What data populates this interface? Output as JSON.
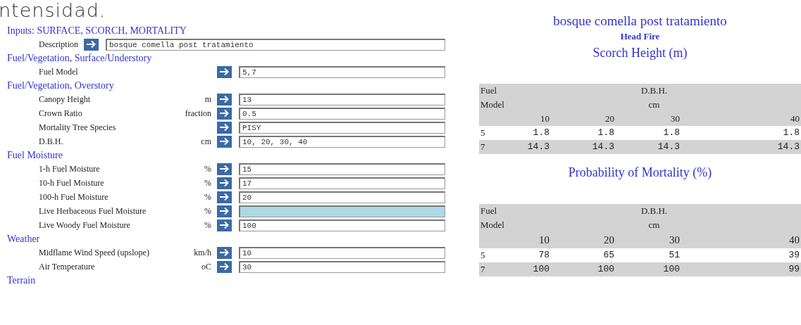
{
  "intro_text": "ntensidad.",
  "inputs": {
    "title": "Inputs: SURFACE, SCORCH, MORTALITY",
    "description": {
      "label": "Description",
      "value": "bosque comella post tratamiento"
    },
    "sections": [
      {
        "title": "Fuel/Vegetation, Surface/Understory",
        "fields": [
          {
            "label": "Fuel Model",
            "value": "5,7",
            "highlighted": false
          }
        ]
      },
      {
        "title": "Fuel/Vegetation, Overstory",
        "fields": [
          {
            "label": "Canopy Height",
            "unit": "m",
            "value": "13",
            "highlighted": false
          },
          {
            "label": "Crown Ratio",
            "unit": "fraction",
            "value": "0.5",
            "highlighted": false
          },
          {
            "label": "Mortality Tree Species",
            "value": "PISY",
            "highlighted": false
          },
          {
            "label": "D.B.H.",
            "unit": "cm",
            "value": "10, 20, 30, 40",
            "highlighted": false
          }
        ]
      },
      {
        "title": "Fuel Moisture",
        "fields": [
          {
            "label": "1-h Fuel Moisture",
            "unit": "%",
            "value": "15",
            "highlighted": false
          },
          {
            "label": "10-h Fuel Moisture",
            "unit": "%",
            "value": "17",
            "highlighted": false
          },
          {
            "label": "100-h Fuel Moisture",
            "unit": "%",
            "value": "20",
            "highlighted": false
          },
          {
            "label": "Live Herbaceous Fuel Moisture",
            "unit": "%",
            "highlighted": true
          },
          {
            "label": "Live Woody Fuel Moisture",
            "unit": "%",
            "value": "100",
            "highlighted": false
          }
        ]
      },
      {
        "title": "Weather",
        "fields": [
          {
            "label": "Midflame Wind Speed (upslope)",
            "unit": "km/h",
            "value": "10",
            "highlighted": false
          },
          {
            "label": "Air Temperature",
            "unit": "oC",
            "value": "30",
            "highlighted": false
          }
        ]
      },
      {
        "title": "Terrain"
      }
    ]
  },
  "results": {
    "title": "bosque comella post tratamiento",
    "subtitle": "Head Fire",
    "tables": [
      {
        "title": "Scorch Height (m)",
        "first_header": [
          "Fuel",
          "Model"
        ],
        "group_header": [
          "D.B.H.",
          "cm"
        ],
        "columns": [
          "10",
          "20",
          "30",
          "40"
        ],
        "rows": [
          {
            "fuel_model": "5",
            "values": [
              "1.8",
              "1.8",
              "1.8",
              "1.8"
            ]
          },
          {
            "fuel_model": "7",
            "values": [
              "14.3",
              "14.3",
              "14.3",
              "14.3"
            ]
          }
        ]
      },
      {
        "title": "Probability of Mortality (%)",
        "first_header": [
          "Fuel",
          "Model"
        ],
        "group_header": [
          "D.B.H.",
          "cm"
        ],
        "columns": [
          "10",
          "20",
          "30",
          "40"
        ],
        "rows": [
          {
            "fuel_model": "5",
            "values": [
              "78",
              "65",
              "51",
              "39"
            ]
          },
          {
            "fuel_model": "7",
            "values": [
              "100",
              "100",
              "100",
              "99"
            ]
          }
        ]
      }
    ]
  }
}
